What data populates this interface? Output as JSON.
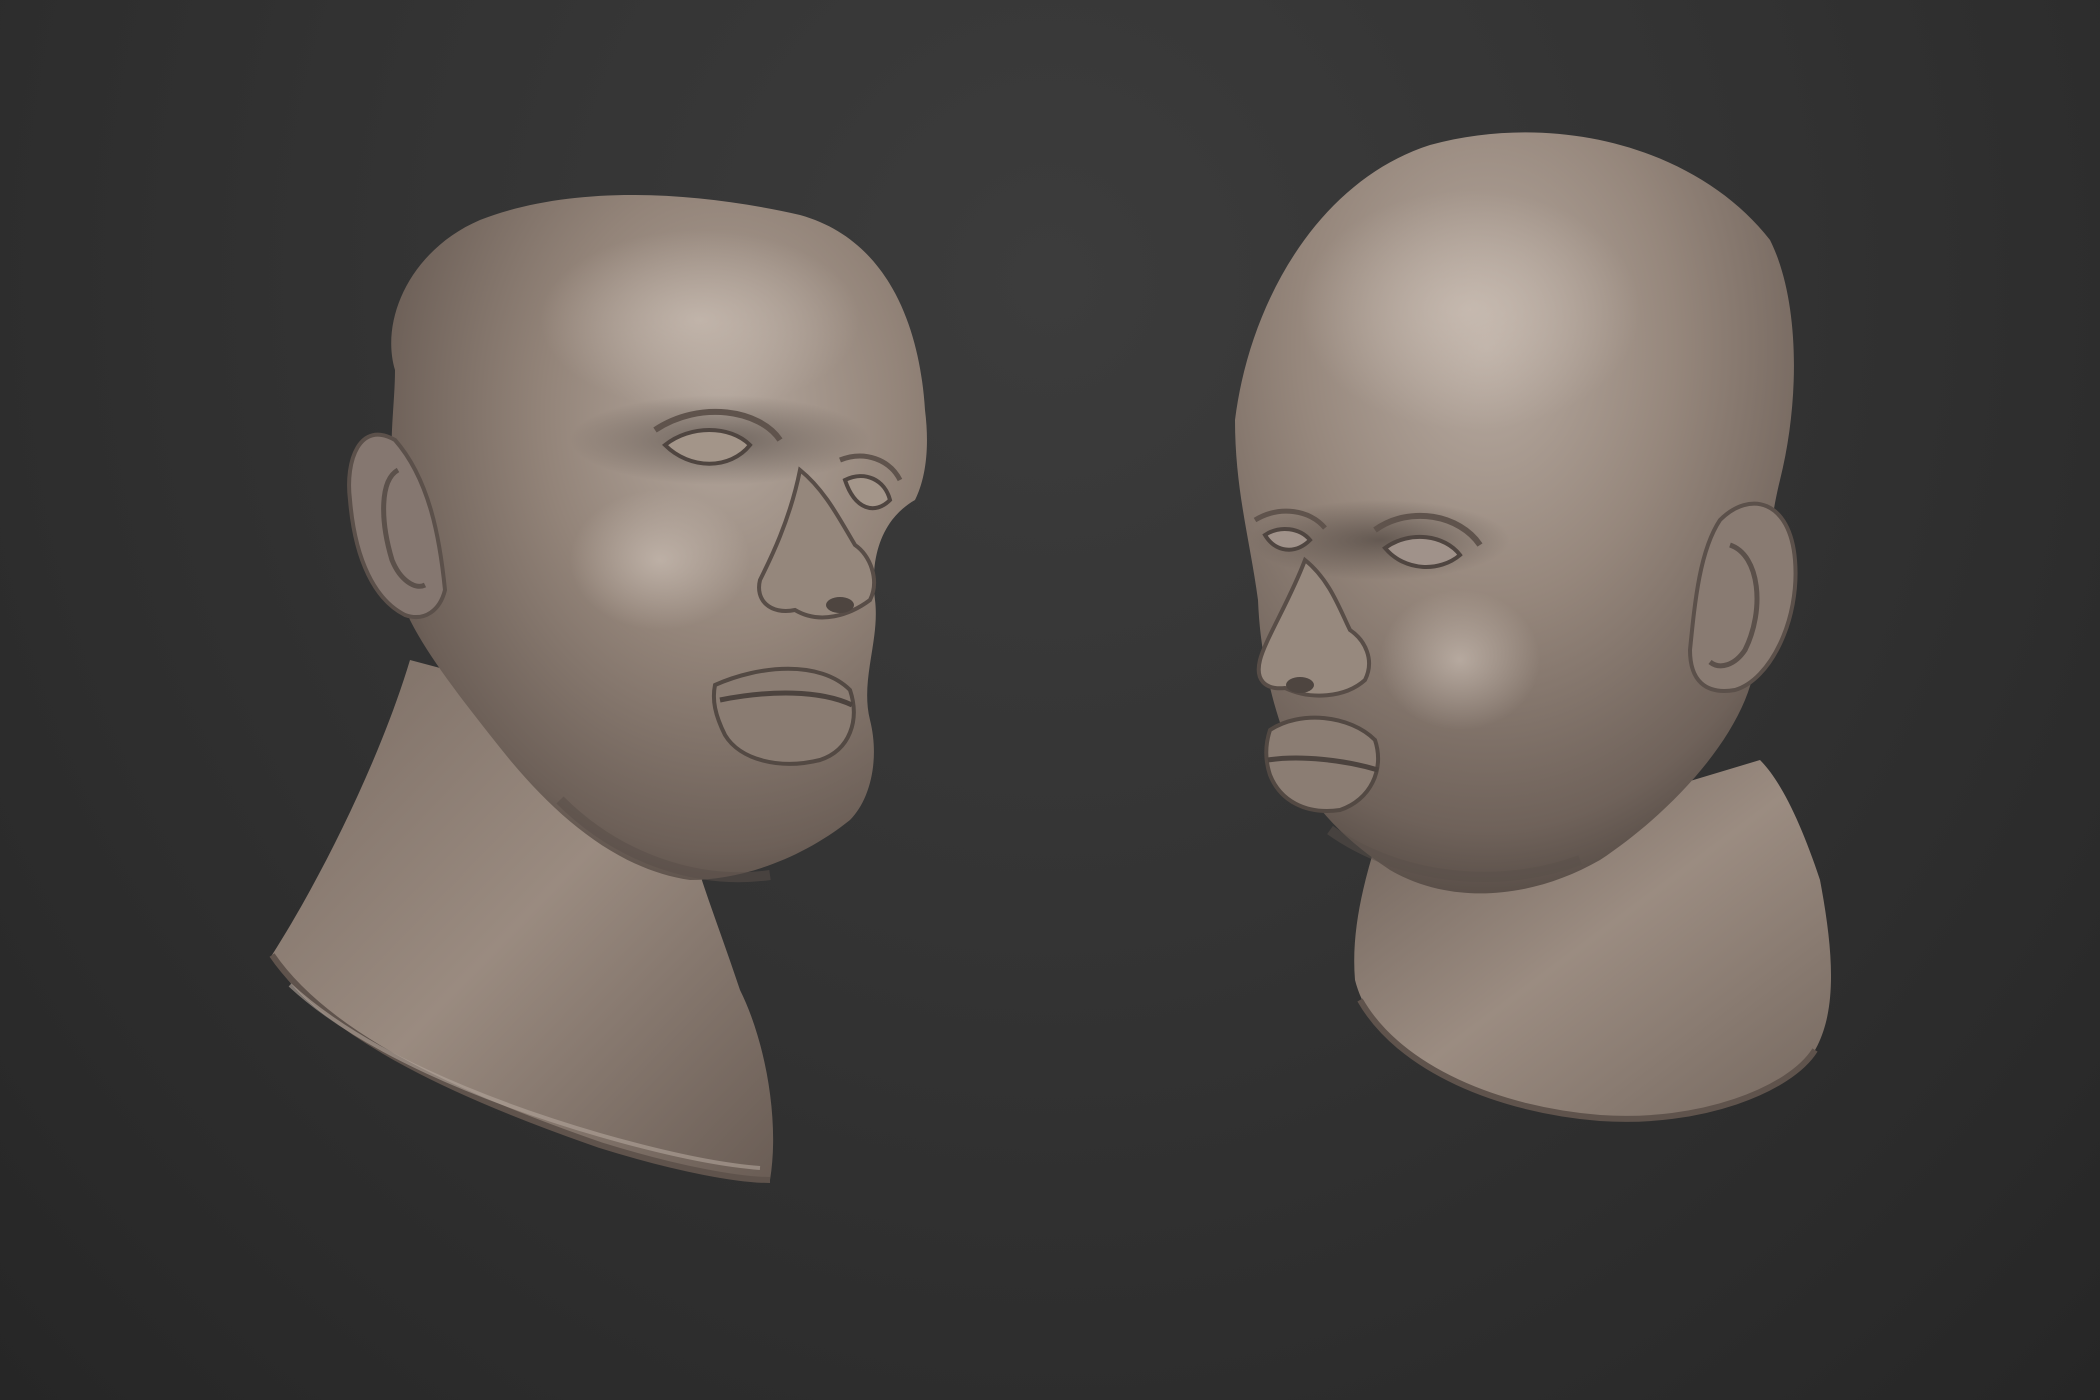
{
  "scene": {
    "background_color": "#2e2e2e",
    "material_color": "#8f8178",
    "highlight_color": "#b3a69c",
    "shadow_color": "#4e4540",
    "objects": [
      {
        "name": "sculpted-head-three-quarter-left",
        "facing": "right"
      },
      {
        "name": "sculpted-head-three-quarter-right",
        "facing": "left"
      }
    ]
  }
}
